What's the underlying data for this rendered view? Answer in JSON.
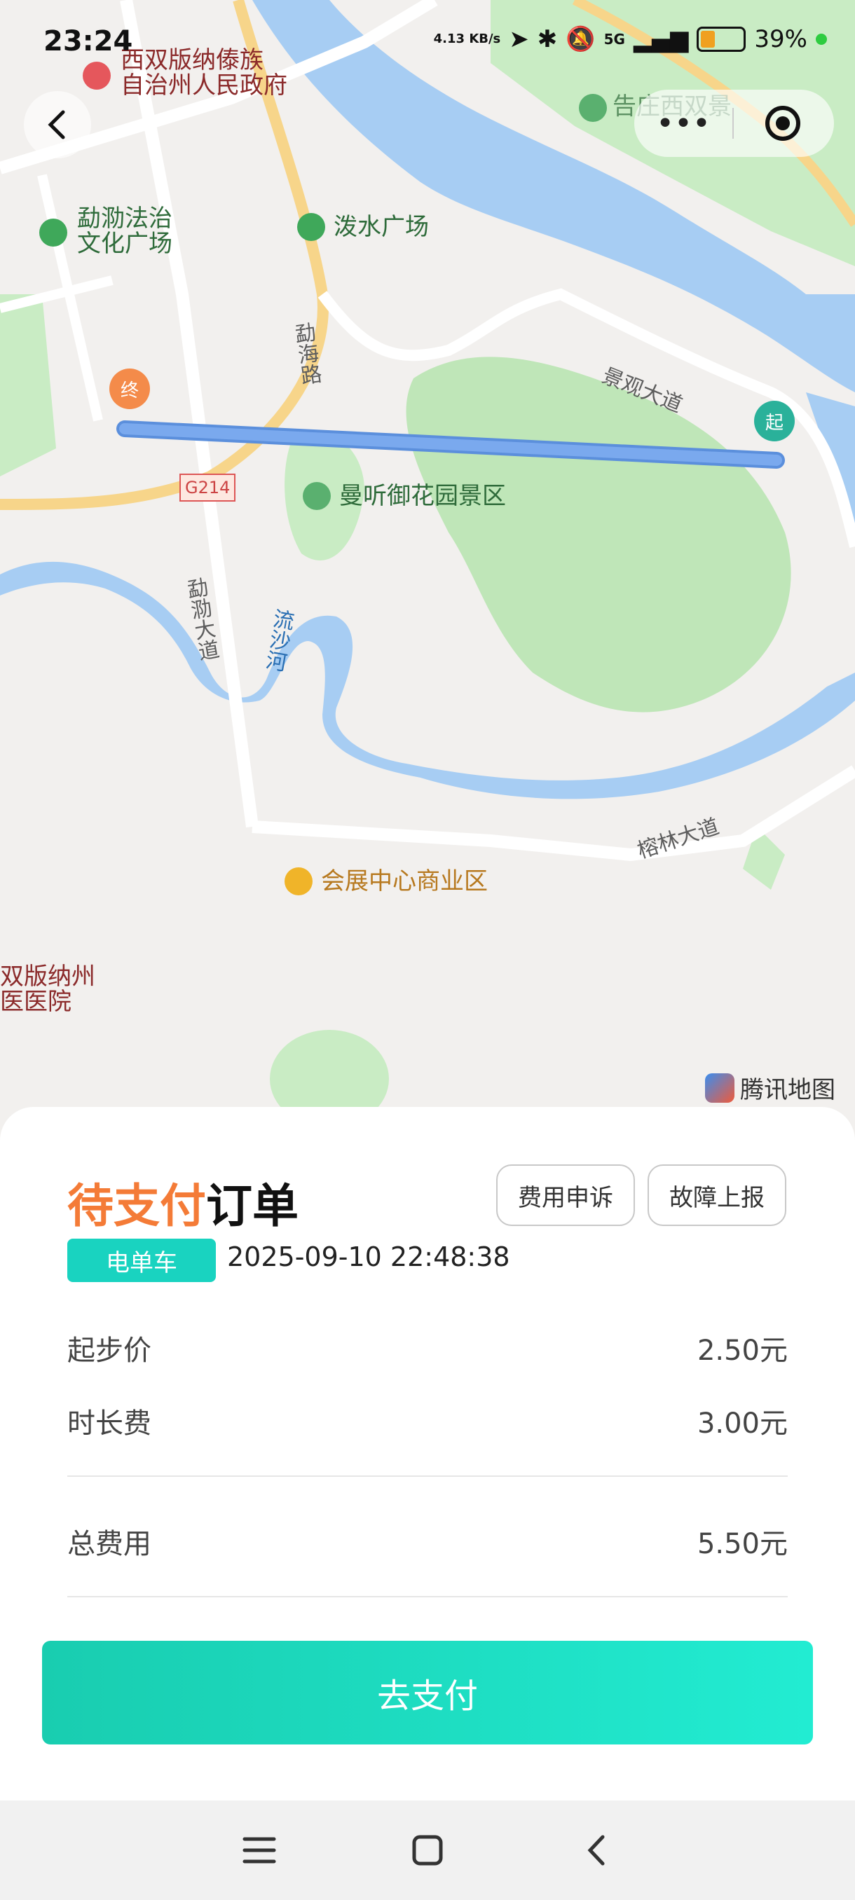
{
  "status": {
    "time": "23:24",
    "net_speed": "4.13 KB/s",
    "network": "5G",
    "battery": "39%"
  },
  "map": {
    "labels": {
      "gov": "西双版纳傣族\n自治州人民政府",
      "law_square": "勐泐法治\n文化广场",
      "water_square": "泼水广场",
      "scenic_top": "告庄西双景",
      "menghai_road": "勐海路",
      "jingguan": "景观大道",
      "garden": "曼听御花园景区",
      "g214": "G214",
      "menghai_dadao": "勐泐大道",
      "river": "流沙河",
      "ronglin": "榕林大道",
      "expo": "会展中心商业区",
      "hospital": "双版纳州\n医医院"
    },
    "start_pin": "起",
    "end_pin": "终",
    "provider": "腾讯地图"
  },
  "order": {
    "status_accent": "待支付",
    "status_rest": "订单",
    "appeal_button": "费用申诉",
    "report_button": "故障上报",
    "vehicle_tag": "电单车",
    "datetime": "2025-09-10 22:48:38",
    "fees": [
      {
        "label": "起步价",
        "value": "2.50元"
      },
      {
        "label": "时长费",
        "value": "3.00元"
      }
    ],
    "total_label": "总费用",
    "total_value": "5.50元",
    "pay_button": "去支付"
  },
  "colors": {
    "accent": "#f47b37",
    "brand": "#19d3c0",
    "route": "#6ea0ea"
  }
}
